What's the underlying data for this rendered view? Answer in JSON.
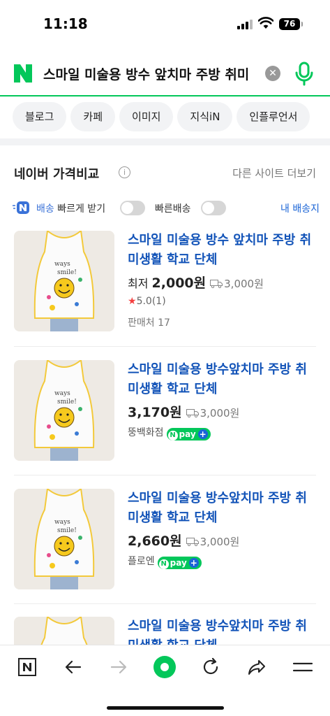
{
  "status": {
    "time": "11:18",
    "battery": "76"
  },
  "search": {
    "query": "스마일 미술용 방수 앞치마 주방 취미",
    "clear_label": "✕"
  },
  "tabs": [
    "블로그",
    "카페",
    "이미지",
    "지식iN",
    "인플루언서"
  ],
  "section": {
    "title": "네이버 가격비교",
    "info_label": "i",
    "more": "다른 사이트 더보기"
  },
  "filter": {
    "delivery_prefix": "배송",
    "delivery_label": "빠르게 받기",
    "fast_shipping": "빠른배송",
    "my_shipping": "내 배송지"
  },
  "products": [
    {
      "title": "스마일 미술용 방수 앞치마 주방 취미생활 학교 단체",
      "price_prefix": "최저",
      "price": "2,000원",
      "shipping": "3,000원",
      "rating_star": "★",
      "rating": "5.0",
      "reviews": "(1)",
      "sellers": "판매처 17",
      "apron_text": [
        "ways",
        "smile!"
      ]
    },
    {
      "title": "스마일 미술용 방수앞치마 주방 취미생활 학교 단체",
      "price": "3,170원",
      "shipping": "3,000원",
      "seller": "뚱백화점",
      "npay": "pay",
      "apron_text": [
        "ways",
        "smile!"
      ]
    },
    {
      "title": "스마일 미술용 방수앞치마 주방 취미생활 학교 단체",
      "price": "2,660원",
      "shipping": "3,000원",
      "seller": "플로엔",
      "npay": "pay",
      "apron_text": [
        "ways",
        "smile!"
      ]
    },
    {
      "title": "스마일 미술용 방수앞치마 주방 취미생활 학교 단체"
    }
  ],
  "npay_n": "N",
  "npay_plus": "+",
  "colors": {
    "naver_green": "#03c75a",
    "link_blue": "#1253b8",
    "star_red": "#f43f3f"
  },
  "bottom_nav": [
    "naver-home-icon",
    "back-arrow-icon",
    "forward-arrow-icon",
    "green-dot-icon",
    "refresh-icon",
    "share-icon",
    "menu-icon"
  ]
}
